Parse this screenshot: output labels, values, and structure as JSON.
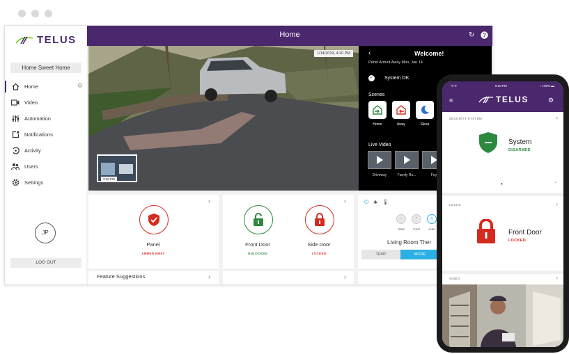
{
  "window_controls": [
    "close",
    "minimize",
    "maximize"
  ],
  "brand": {
    "name": "TELUS",
    "color": "#4b286d"
  },
  "sidebar": {
    "home_selector": "Home Sweet Home",
    "items": [
      {
        "label": "Home",
        "icon": "home-icon",
        "active": true
      },
      {
        "label": "Video",
        "icon": "video-camera-icon"
      },
      {
        "label": "Automation",
        "icon": "automation-icon"
      },
      {
        "label": "Notifications",
        "icon": "notifications-icon"
      },
      {
        "label": "Activity",
        "icon": "activity-icon"
      },
      {
        "label": "Users",
        "icon": "users-icon"
      },
      {
        "label": "Settings",
        "icon": "settings-icon"
      }
    ],
    "avatar_initials": "JP",
    "logout_label": "LOG OUT"
  },
  "header": {
    "title": "Home"
  },
  "camera": {
    "timestamp": "1/14/2019, 4:20 PM",
    "pip_timestamp": "3:16 PM"
  },
  "welcome_panel": {
    "title": "Welcome!",
    "subtitle": "Panel Armed Away Mon, Jan 14",
    "system_status": "System OK",
    "scenes_title": "Scenes",
    "scenes": [
      {
        "label": "Home",
        "icon": "home-arrow-icon"
      },
      {
        "label": "Away",
        "icon": "away-arrow-icon"
      },
      {
        "label": "Sleep",
        "icon": "moon-icon"
      }
    ],
    "live_video_title": "Live Video",
    "live_videos": [
      {
        "label": "Driveway"
      },
      {
        "label": "Family Ro..."
      },
      {
        "label": "Foy"
      }
    ]
  },
  "cards": {
    "panel": {
      "label": "Panel",
      "status": "ARMED AWAY"
    },
    "front_door": {
      "label": "Front Door",
      "status": "UNLOCKED"
    },
    "side_door": {
      "label": "Side Door",
      "status": "LOCKED"
    },
    "thermostat": {
      "name": "Living Room Ther",
      "modes": [
        {
          "label": "Heat",
          "glyph": "~"
        },
        {
          "label": "Cool",
          "glyph": "*"
        },
        {
          "label": "Auto",
          "glyph": "A"
        }
      ],
      "tabs": {
        "temp": "TEMP",
        "mode": "MODE"
      }
    },
    "feature_suggestions": "Feature Suggestions"
  },
  "phone": {
    "carrier": "•ıl ᯤ",
    "time": "8:28 PM",
    "battery": "↑ 100% ▬",
    "security_label": "SECURITY SYSTEM",
    "system_title": "System",
    "system_state": "DISARMED",
    "locks_label": "LOCKS",
    "lock_title": "Front Door",
    "lock_state": "LOCKED",
    "video_label": "VIDEO"
  },
  "colors": {
    "purple": "#4b286d",
    "green": "#2b8a3e",
    "red": "#d52b1e",
    "blue_accent": "#2ab0e4"
  }
}
